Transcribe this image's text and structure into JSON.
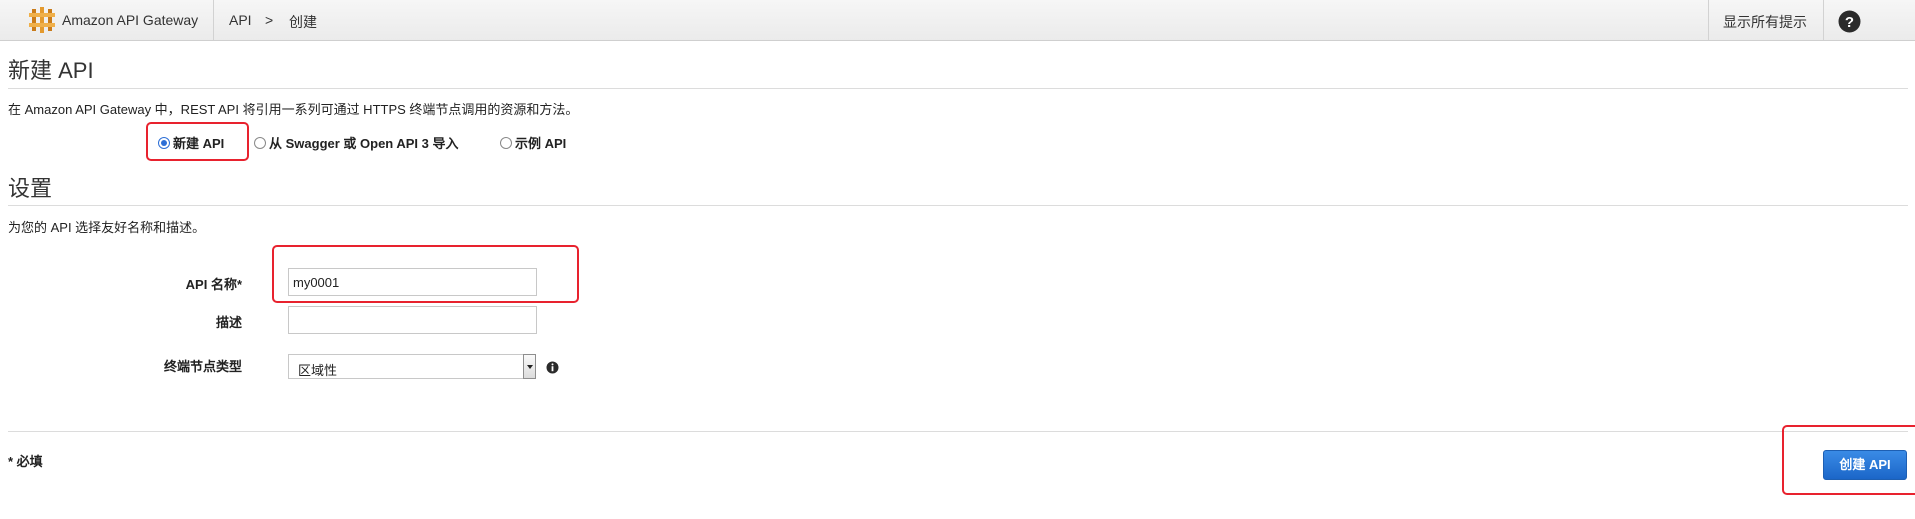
{
  "header": {
    "service_name": "Amazon API Gateway",
    "breadcrumb": [
      "API",
      ">",
      "创建"
    ],
    "hints_label": "显示所有提示",
    "logo_icon": "api-gateway-logo-icon",
    "help_icon": "question-circle-icon"
  },
  "page": {
    "title": "新建 API",
    "intro": "在 Amazon API Gateway 中，REST API 将引用一系列可通过 HTTPS 终端节点调用的资源和方法。",
    "api_options": [
      {
        "label": "新建 API",
        "checked": true
      },
      {
        "label": "从 Swagger 或 Open API 3 导入",
        "checked": false
      },
      {
        "label": "示例 API",
        "checked": false
      }
    ]
  },
  "settings": {
    "title": "设置",
    "subtitle": "为您的 API 选择友好名称和描述。",
    "name_label": "API 名称*",
    "name_value": "my0001",
    "description_label": "描述",
    "description_value": "",
    "endpoint_label": "终端节点类型",
    "endpoint_value": "区域性",
    "info_icon": "info-circle-icon"
  },
  "footer": {
    "required_note": "* 必填",
    "create_button": "创建 API"
  },
  "colors": {
    "highlight": "#e8222e",
    "primary_button": "#1b66c8",
    "radio_checked": "#2d6fd6"
  }
}
